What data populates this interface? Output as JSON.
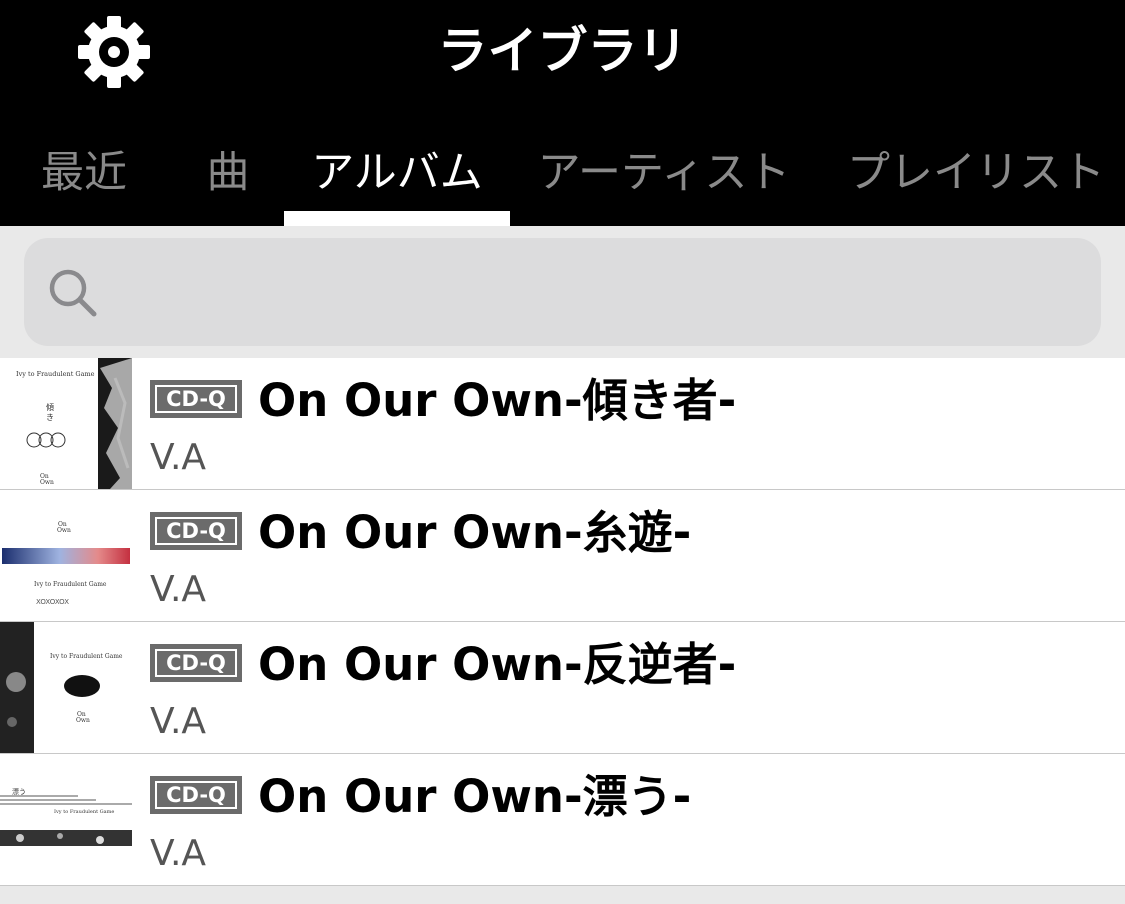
{
  "header": {
    "title": "ライブラリ",
    "settings_icon": "gear-icon"
  },
  "tabs": [
    {
      "label": "最近",
      "active": false
    },
    {
      "label": "曲",
      "active": false
    },
    {
      "label": "アルバム",
      "active": true
    },
    {
      "label": "アーティスト",
      "active": false
    },
    {
      "label": "プレイリスト",
      "active": false
    }
  ],
  "search": {
    "icon": "search-icon",
    "value": "",
    "placeholder": ""
  },
  "albums": [
    {
      "badge": "CD-Q",
      "title": "On Our Own-傾き者-",
      "artist": "V.A",
      "art_text": "Ivy to Fraudulent Game"
    },
    {
      "badge": "CD-Q",
      "title": "On Our Own-糸遊-",
      "artist": "V.A",
      "art_text": "Ivy to Fraudulent Game"
    },
    {
      "badge": "CD-Q",
      "title": "On Our Own-反逆者-",
      "artist": "V.A",
      "art_text": "Ivy to Fraudulent Game"
    },
    {
      "badge": "CD-Q",
      "title": "On Our Own-漂う-",
      "artist": "V.A",
      "art_text": "Ivy to Fraudulent Game"
    }
  ],
  "colors": {
    "header_bg": "#000000",
    "active_tab": "#ffffff",
    "inactive_tab": "#8a8a8a",
    "badge_bg": "#6b6b6b"
  }
}
